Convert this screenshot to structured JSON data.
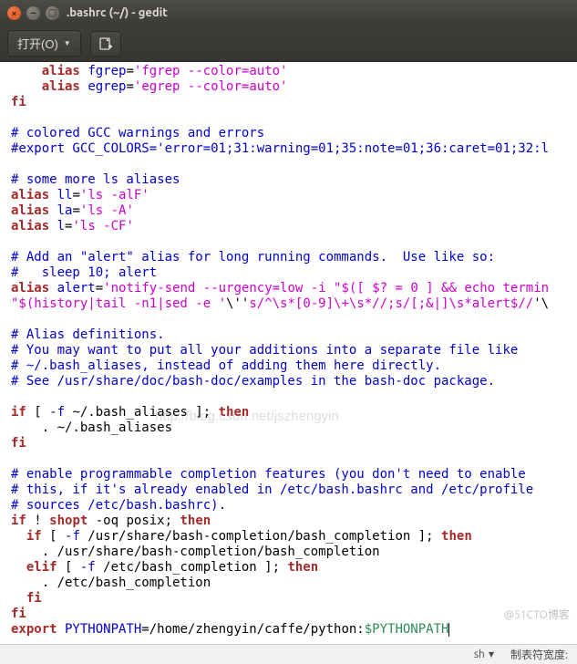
{
  "window": {
    "title": ".bashrc (~/) - gedit"
  },
  "toolbar": {
    "open_label": "打开(O)"
  },
  "code": {
    "l1_a": "alias",
    "l1_b": "fgrep",
    "l1_c": "'fgrep --color=auto'",
    "l2_a": "alias",
    "l2_b": "egrep",
    "l2_c": "'egrep --color=auto'",
    "l3": "fi",
    "l5": "# colored GCC warnings and errors",
    "l6": "#export GCC_COLORS='error=01;31:warning=01;35:note=01;36:caret=01;32:l",
    "l8": "# some more ls aliases",
    "l9_a": "alias",
    "l9_b": "ll",
    "l9_c": "'ls -alF'",
    "l10_a": "alias",
    "l10_b": "la",
    "l10_c": "'ls -A'",
    "l11_a": "alias",
    "l11_b": "l",
    "l11_c": "'ls -CF'",
    "l13": "# Add an \"alert\" alias for long running commands.  Use like so:",
    "l14": "#   sleep 10; alert",
    "l15_a": "alias",
    "l15_b": "alert",
    "l15_c": "'notify-send --urgency=low -i \"$([ $? = 0 ] && echo termin",
    "l16": "\"$(history|tail -n1|sed -e '",
    "l16b": "\\''",
    "l16c": "s/^\\s*[0-9]\\+\\s*//;s/[;&|]\\s*alert$//",
    "l16d": "'\\",
    "l18": "# Alias definitions.",
    "l19": "# You may want to put all your additions into a separate file like",
    "l20": "# ~/.bash_aliases, instead of adding them here directly.",
    "l21": "# See /usr/share/doc/bash-doc/examples in the bash-doc package.",
    "l23_a": "if",
    "l23_b": " [ ",
    "l23_c": "-f",
    "l23_d": " ~/.bash_aliases ]; ",
    "l23_e": "then",
    "l24": "    . ~/.bash_aliases",
    "l25": "fi",
    "l27": "# enable programmable completion features (you don't need to enable",
    "l28": "# this, if it's already enabled in /etc/bash.bashrc and /etc/profile",
    "l29": "# sources /etc/bash.bashrc).",
    "l30_a": "if",
    "l30_b": " ! ",
    "l30_c": "shopt",
    "l30_d": " -oq posix; ",
    "l30_e": "then",
    "l31_a": "  if",
    "l31_b": " [ ",
    "l31_c": "-f",
    "l31_d": " /usr/share/bash-completion/bash_completion ]; ",
    "l31_e": "then",
    "l32": "    . /usr/share/bash-completion/bash_completion",
    "l33_a": "  elif",
    "l33_b": " [ ",
    "l33_c": "-f",
    "l33_d": " /etc/bash_completion ]; ",
    "l33_e": "then",
    "l34": "    . /etc/bash_completion",
    "l35": "  fi",
    "l36": "fi",
    "l37_a": "export",
    "l37_b": " PYTHONPATH",
    "l37_c": "=/home/zhengyin/caffe/python:",
    "l37_d": "$PYTHONPATH"
  },
  "watermark": "http://blog.csdn.net/jszhengyin",
  "bottom_watermark": "@51CTO博客",
  "status": {
    "lang": "sh",
    "tab_label": "制表符宽度:"
  }
}
